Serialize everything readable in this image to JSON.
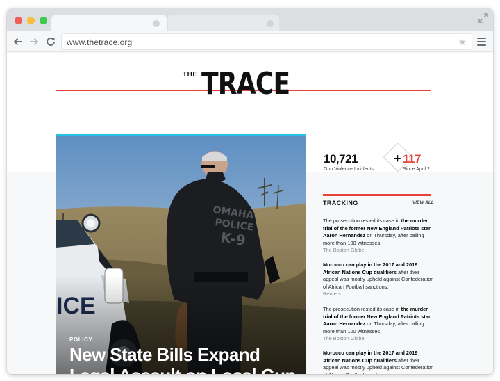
{
  "browser": {
    "url": "www.thetrace.org"
  },
  "site": {
    "logo_small": "THE",
    "logo_big": "TRACE"
  },
  "hero": {
    "tag": "POLICY",
    "title": "New State Bills Expand Legal Assault on Local Gun",
    "image_caption_text": [
      "OMAHA",
      "POLICE",
      "K-9",
      "ICE"
    ]
  },
  "stats": {
    "incidents": "10,721",
    "incidents_label": "Gun Violence Incidents",
    "plus": "+",
    "delta": "117",
    "since_label": "Since April 2"
  },
  "tracking": {
    "title": "TRACKING",
    "view_all": "VIEW ALL",
    "items": [
      {
        "pre": "The prosecution rested its case in ",
        "bold": "the murder trial of the former New England Patriots star Aaron Hernandez",
        "post": " on Thursday, after calling more than 100 witnesses.",
        "source": "The Boston Globe"
      },
      {
        "pre": "",
        "bold": "Morocco can play in the 2017 and 2019 African Nations Cup qualifiers",
        "post": " after their appeal was mostly upheld against Confederation of African Football sanctions.",
        "source": "Reuters"
      },
      {
        "pre": "The prosecution rested its case in ",
        "bold": "the murder trial of the former New England Patriots star Aaron Hernandez",
        "post": " on Thursday, after calling more than 100 witnesses.",
        "source": "The Boston Globe"
      },
      {
        "pre": "",
        "bold": "Morocco can play in the 2017 and 2019 African Nations Cup qualifiers",
        "post": " after their appeal was mostly upheld against Confederation of African Football sanctions.",
        "source": ""
      }
    ]
  },
  "colors": {
    "accent_red": "#e8413a",
    "accent_blue": "#25c1e6"
  }
}
